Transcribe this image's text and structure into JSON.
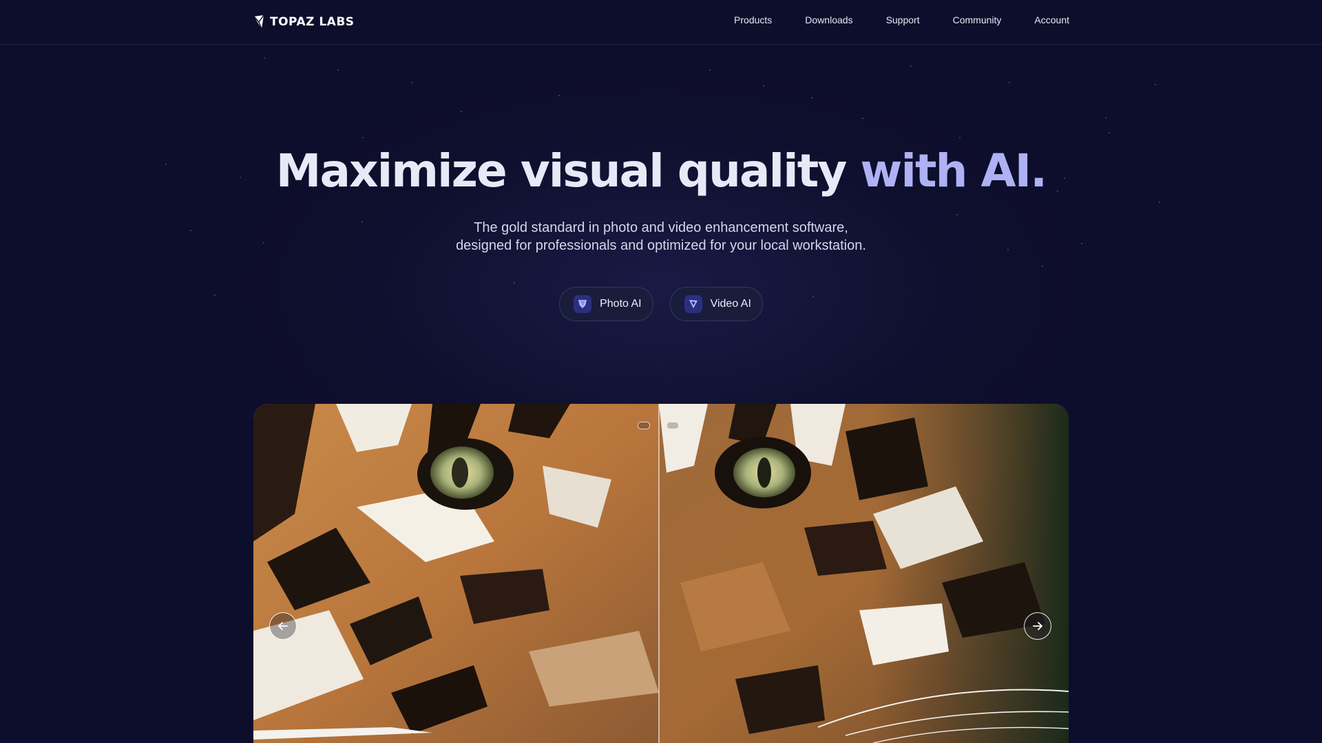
{
  "brand": {
    "name": "TOPAZ LABS"
  },
  "nav": {
    "links": [
      "Products",
      "Downloads",
      "Support",
      "Community",
      "Account"
    ]
  },
  "hero": {
    "title_part1": "Maximize visual quality",
    "title_part2": "with AI.",
    "subtitle_line1": "The gold standard in photo and video enhancement software,",
    "subtitle_line2": "designed for professionals and optimized for your local workstation."
  },
  "cta": {
    "photo_label": "Photo AI",
    "video_label": "Video AI"
  },
  "comparison": {
    "before_label": "",
    "after_label": "",
    "split_position_fraction": 0.5
  },
  "icons": {
    "logo": "topaz-logo-icon",
    "photo": "photo-ai-icon",
    "video": "video-ai-icon",
    "prev": "arrow-left-icon",
    "next": "arrow-right-icon"
  },
  "colors": {
    "background": "#0d0e2b",
    "title_primary": "#e8e9f7",
    "title_accent": "#aeb1f3",
    "button_bg": "#1a1c3c"
  }
}
